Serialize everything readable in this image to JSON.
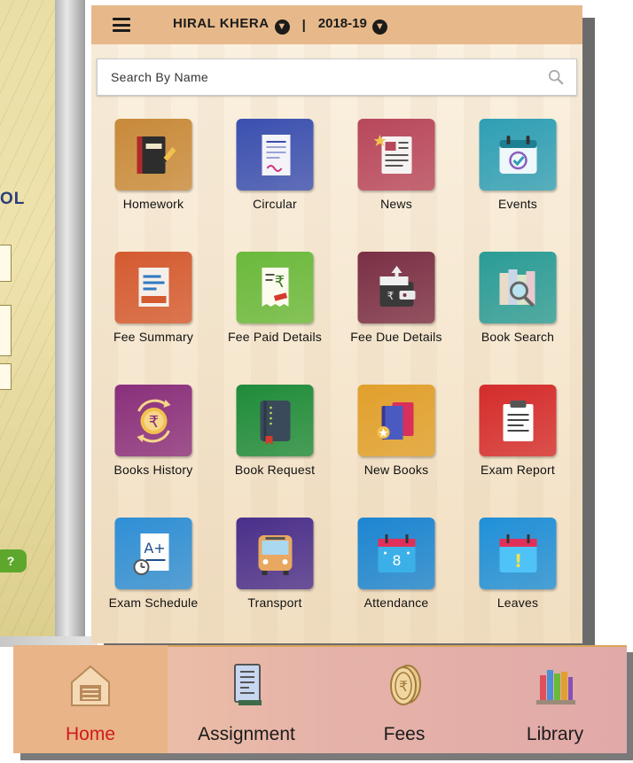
{
  "header": {
    "student_name": "HIRAL  KHERA",
    "separator": "|",
    "session": "2018-19",
    "dropdown_glyph": "▼"
  },
  "search": {
    "placeholder": "Search By Name",
    "value": ""
  },
  "background": {
    "partial_heading": "OL",
    "help_badge": "?"
  },
  "tiles": [
    {
      "label": "Homework",
      "icon": "homework-book-icon",
      "color": "#c88a3a"
    },
    {
      "label": "Circular",
      "icon": "circular-document-icon",
      "color": "#3a4fb0"
    },
    {
      "label": "News",
      "icon": "news-icon",
      "color": "#b8475c"
    },
    {
      "label": "Events",
      "icon": "events-calendar-icon",
      "color": "#2f9fb5"
    },
    {
      "label": "Fee Summary",
      "icon": "fee-summary-icon",
      "color": "#d45a30"
    },
    {
      "label": "Fee Paid Details",
      "icon": "fee-paid-receipt-icon",
      "color": "#6ab93b"
    },
    {
      "label": "Fee Due Details",
      "icon": "wallet-icon",
      "color": "#7a2f45"
    },
    {
      "label": "Book Search",
      "icon": "book-search-icon",
      "color": "#2a9c96"
    },
    {
      "label": "Books History",
      "icon": "books-history-icon",
      "color": "#8a2f7c"
    },
    {
      "label": "Book Request",
      "icon": "book-request-icon",
      "color": "#1e8c3a"
    },
    {
      "label": "New Books",
      "icon": "new-books-icon",
      "color": "#e1a02c"
    },
    {
      "label": "Exam Report",
      "icon": "exam-report-icon",
      "color": "#d42c2c"
    },
    {
      "label": "Exam Schedule",
      "icon": "exam-schedule-icon",
      "color": "#2f8fd6"
    },
    {
      "label": "Transport",
      "icon": "bus-icon",
      "color": "#4a2f8c"
    },
    {
      "label": "Attendance",
      "icon": "attendance-calendar-icon",
      "color": "#1c86d2"
    },
    {
      "label": "Leaves",
      "icon": "leaves-calendar-icon",
      "color": "#2090d8"
    }
  ],
  "bottom_nav": [
    {
      "label": "Home",
      "icon": "home-icon",
      "active": true
    },
    {
      "label": "Assignment",
      "icon": "assignment-icon",
      "active": false
    },
    {
      "label": "Fees",
      "icon": "fees-coins-icon",
      "active": false
    },
    {
      "label": "Library",
      "icon": "library-icon",
      "active": false
    }
  ],
  "colors": {
    "header_bg": "#e7b98a",
    "active_nav_text": "#d11a1a"
  }
}
